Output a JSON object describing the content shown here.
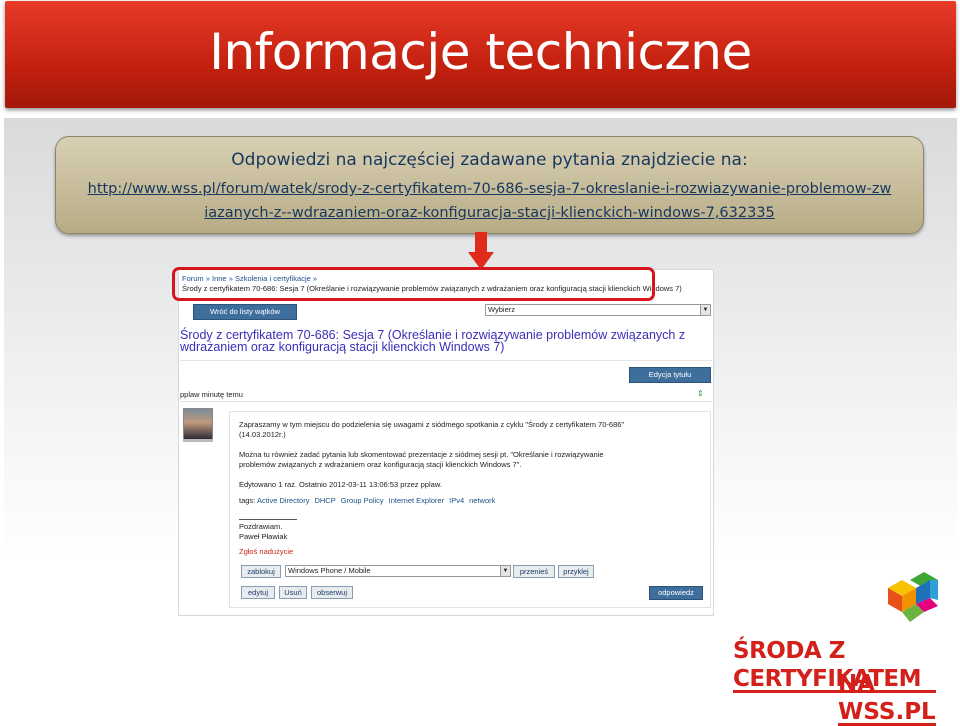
{
  "slide": {
    "title": "Informacje techniczne",
    "callout": {
      "question": "Odpowiedzi na najczęściej zadawane pytania znajdziecie na:",
      "url": "http://www.wss.pl/forum/watek/srody-z-certyfikatem-70-686-sesja-7-okreslanie-i-rozwiazywanie-problemow-zwiazanych-z--wdrazaniem-oraz-konfiguracja-stacji-klienckich-windows-7,632335"
    },
    "colors": {
      "title_bar": "#c4210f",
      "callout_bg": "#c9bf9c",
      "callout_text": "#17375e",
      "highlight": "#d8151d",
      "brand": "#d4201a"
    }
  },
  "forum": {
    "breadcrumb": "Forum » Inne » Szkolenia i certyfikacje »",
    "breadcrumb_title": "Środy z certyfikatem 70-686: Sesja 7 (Określanie i rozwiązywanie problemów związanych z wdrażaniem oraz konfiguracją stacji klienckich Windows 7)",
    "back_button": "Wróć do listy wątków",
    "select_label": "Wybierz",
    "thread_title": "Środy z certyfikatem 70-686: Sesja 7 (Określanie i rozwiązywanie problemów związanych z wdrażaniem oraz konfiguracją stacji klienckich Windows 7)",
    "edit_title_button": "Edycja tytułu",
    "thread_meta": "pplaw minutę temu",
    "post": {
      "paragraph1": "Zapraszamy w tym miejscu do podzielenia się uwagami z siódmego spotkania z cyklu \"Środy z certyfikatem 70-686\" (14.03.2012r.)",
      "paragraph2": "Można tu również zadać pytania lub skomentować prezentacje z siódmej sesji pt. \"Określanie i rozwiązywanie problemów związanych z wdrażaniem oraz konfiguracją stacji klienckich Windows 7\".",
      "edited": "Edytowano 1 raz. Ostatnio 2012-03-11 13:06:53 przez pplaw.",
      "tags_label": "tags:",
      "tags": [
        "Active Directory",
        "DHCP",
        "Group Policy",
        "Internet Explorer",
        "IPv4",
        "network"
      ],
      "greeting": "Pozdrawiam.",
      "signature": "Paweł Pławiak",
      "report_link": "Zgłoś nadużycie"
    },
    "actions": {
      "lock": "zablokuj",
      "move_target": "Windows Phone / Mobile",
      "move": "przenieś",
      "glue": "przyklej",
      "edit": "edytuj",
      "delete": "Usuń",
      "watch": "obserwuj",
      "reply": "odpowiedz"
    }
  },
  "brand": {
    "line1": "ŚRODA Z CERTYFIKATEM",
    "line2": "NA WSS.PL"
  }
}
